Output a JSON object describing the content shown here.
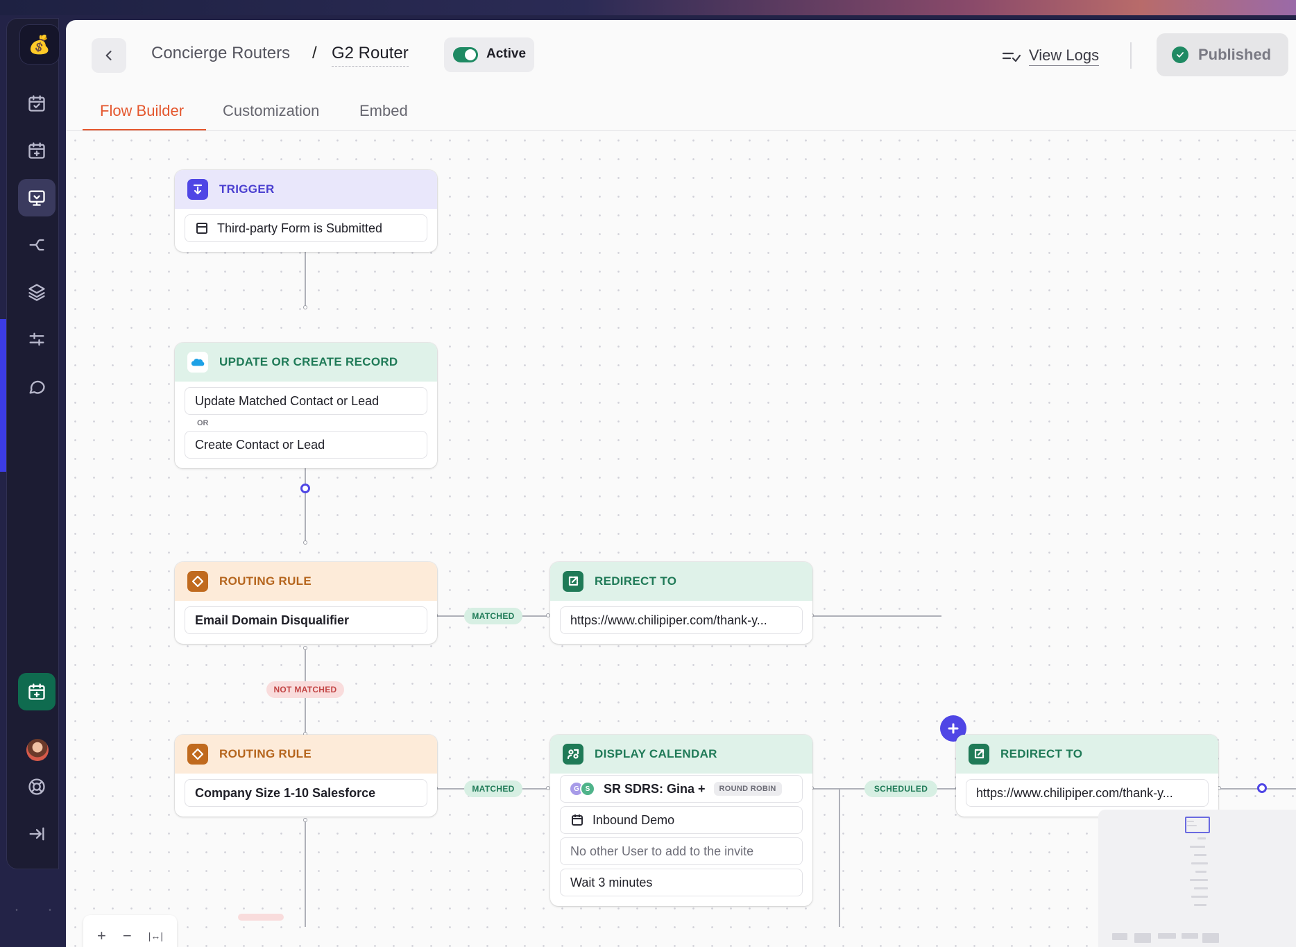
{
  "app": {
    "logo_emoji": "💰",
    "accent": "#4f46e5",
    "brand_orange": "#e4572e",
    "success_green": "#1f8a63"
  },
  "sidebar": {
    "items": [
      {
        "name": "calendar-sync-icon"
      },
      {
        "name": "calendar-add-icon"
      },
      {
        "name": "concierge-icon",
        "active": true
      },
      {
        "name": "handoff-icon"
      },
      {
        "name": "layers-icon"
      },
      {
        "name": "sliders-icon"
      },
      {
        "name": "chat-icon"
      }
    ],
    "bottom": [
      {
        "name": "calendar-app-icon"
      },
      {
        "name": "avatar"
      },
      {
        "name": "help-icon"
      },
      {
        "name": "collapse-icon"
      }
    ]
  },
  "header": {
    "breadcrumb_parent": "Concierge Routers",
    "separator": "/",
    "title": "G2 Router",
    "status_label": "Active",
    "status_on": true,
    "view_logs": "View Logs",
    "publish_label": "Published"
  },
  "tabs": [
    {
      "label": "Flow Builder",
      "active": true
    },
    {
      "label": "Customization"
    },
    {
      "label": "Embed"
    }
  ],
  "flow": {
    "trigger": {
      "title": "TRIGGER",
      "field": "Third-party Form is Submitted"
    },
    "update": {
      "title": "UPDATE OR CREATE RECORD",
      "field1": "Update Matched Contact or Lead",
      "or": "OR",
      "field2": "Create Contact or Lead"
    },
    "rule1": {
      "title": "ROUTING RULE",
      "field": "Email Domain Disqualifier"
    },
    "redirect1": {
      "title": "REDIRECT TO",
      "field": "https://www.chilipiper.com/thank-y..."
    },
    "rule2": {
      "title": "ROUTING RULE",
      "field": "Company Size 1-10 Salesforce"
    },
    "calendar": {
      "title": "DISPLAY CALENDAR",
      "assignees": "SR SDRS: Gina +",
      "avatar1": "G",
      "avatar2": "S",
      "badge": "ROUND ROBIN",
      "meeting": "Inbound Demo",
      "guests": "No other User to add to the invite",
      "wait": "Wait 3 minutes"
    },
    "redirect2": {
      "title": "REDIRECT TO",
      "field": "https://www.chilipiper.com/thank-y..."
    },
    "labels": {
      "matched": "MATCHED",
      "not_matched": "NOT MATCHED",
      "scheduled": "SCHEDULED"
    }
  },
  "zoom": {
    "in": "+",
    "out": "−",
    "fit": "|↔|"
  }
}
